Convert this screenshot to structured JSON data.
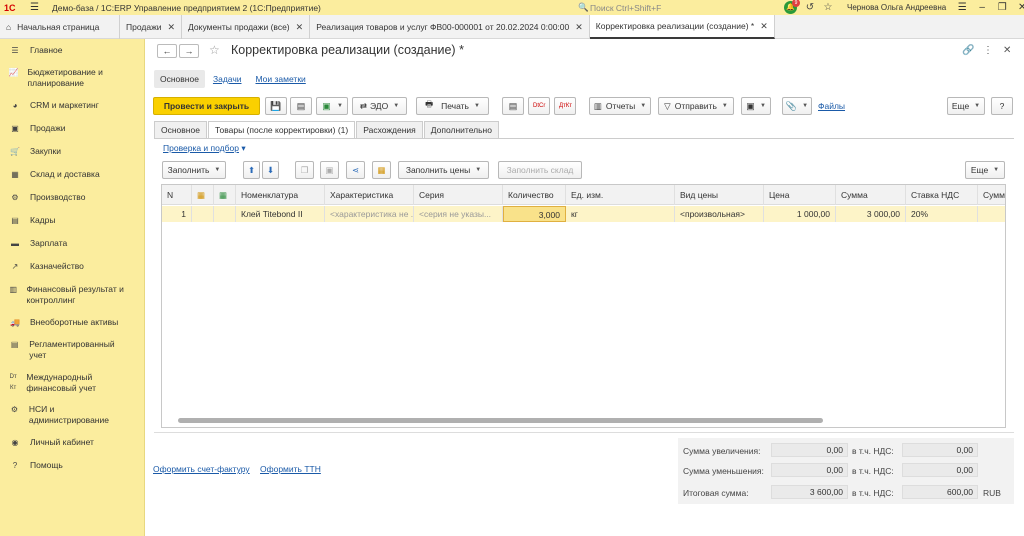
{
  "app": {
    "logo": "1С",
    "title": "Демо-база / 1С:ERP Управление предприятием 2  (1С:Предприятие)"
  },
  "search_placeholder": "Поиск Ctrl+Shift+F",
  "user": "Чернова Ольга Андреевна",
  "tabs": [
    {
      "label": "Начальная страница"
    },
    {
      "label": "Продажи"
    },
    {
      "label": "Документы продажи (все)"
    },
    {
      "label": "Реализация товаров и услуг ФВ00-000001 от 20.02.2024 0:00:00"
    },
    {
      "label": "Корректировка реализации (создание) *"
    }
  ],
  "sidebar": {
    "items": [
      {
        "label": "Главное",
        "icon": "menu-icon"
      },
      {
        "label": "Бюджетирование и планирование",
        "icon": "chart-icon"
      },
      {
        "label": "CRM и маркетинг",
        "icon": "pie-icon"
      },
      {
        "label": "Продажи",
        "icon": "bag-icon"
      },
      {
        "label": "Закупки",
        "icon": "cart-icon"
      },
      {
        "label": "Склад и доставка",
        "icon": "warehouse-icon"
      },
      {
        "label": "Производство",
        "icon": "factory-icon"
      },
      {
        "label": "Кадры",
        "icon": "people-icon"
      },
      {
        "label": "Зарплата",
        "icon": "money-icon"
      },
      {
        "label": "Казначейство",
        "icon": "treasury-icon"
      },
      {
        "label": "Финансовый результат и контроллинг",
        "icon": "finance-icon"
      },
      {
        "label": "Внеоборотные активы",
        "icon": "truck-icon"
      },
      {
        "label": "Регламентированный учет",
        "icon": "document-icon"
      },
      {
        "label": "Международный финансовый учет",
        "icon": "dtkt-icon"
      },
      {
        "label": "НСИ и администрирование",
        "icon": "gear-icon"
      },
      {
        "label": "Личный кабинет",
        "icon": "user-icon"
      },
      {
        "label": "Помощь",
        "icon": "help-icon"
      }
    ]
  },
  "form": {
    "title": "Корректировка реализации (создание) *",
    "links": {
      "main": "Основное",
      "tasks": "Задачи",
      "notes": "Мои заметки"
    },
    "toolbar": {
      "post_close": "Провести и закрыть",
      "edo": "ЭДО",
      "print": "Печать",
      "reports": "Отчеты",
      "send": "Отправить",
      "files": "Файлы",
      "more": "Еще",
      "help": "?"
    },
    "tabs": [
      "Основное",
      "Товары (после корректировки) (1)",
      "Расхождения",
      "Дополнительно"
    ],
    "check_link": "Проверка и подбор",
    "grid_toolbar": {
      "fill": "Заполнить",
      "fill_prices": "Заполнить цены",
      "fill_warehouse": "Заполнить склад",
      "more": "Еще"
    },
    "columns": [
      "N",
      "",
      "",
      "Номенклатура",
      "Характеристика",
      "Серия",
      "Количество",
      "Ед. изм.",
      "Вид цены",
      "Цена",
      "Сумма",
      "Ставка НДС",
      "Сумма"
    ],
    "rows": [
      [
        "1",
        "",
        "",
        "Клей Titebond II",
        "<характеристика не ...",
        "<серия не указы...",
        "3,000",
        "кг",
        "<произвольная>",
        "1 000,00",
        "3 000,00",
        "20%",
        ""
      ]
    ],
    "footer_links": {
      "invoice": "Оформить счет-фактуру",
      "ttn": "Оформить ТТН"
    },
    "totals": {
      "increase_label": "Сумма увеличения:",
      "increase": "0,00",
      "decrease_label": "Сумма уменьшения:",
      "decrease": "0,00",
      "total_label": "Итоговая сумма:",
      "total": "3 600,00",
      "vat_label": "в т.ч. НДС:",
      "vat_inc": "0,00",
      "vat_dec": "0,00",
      "vat_total": "600,00",
      "currency": "RUB"
    }
  }
}
